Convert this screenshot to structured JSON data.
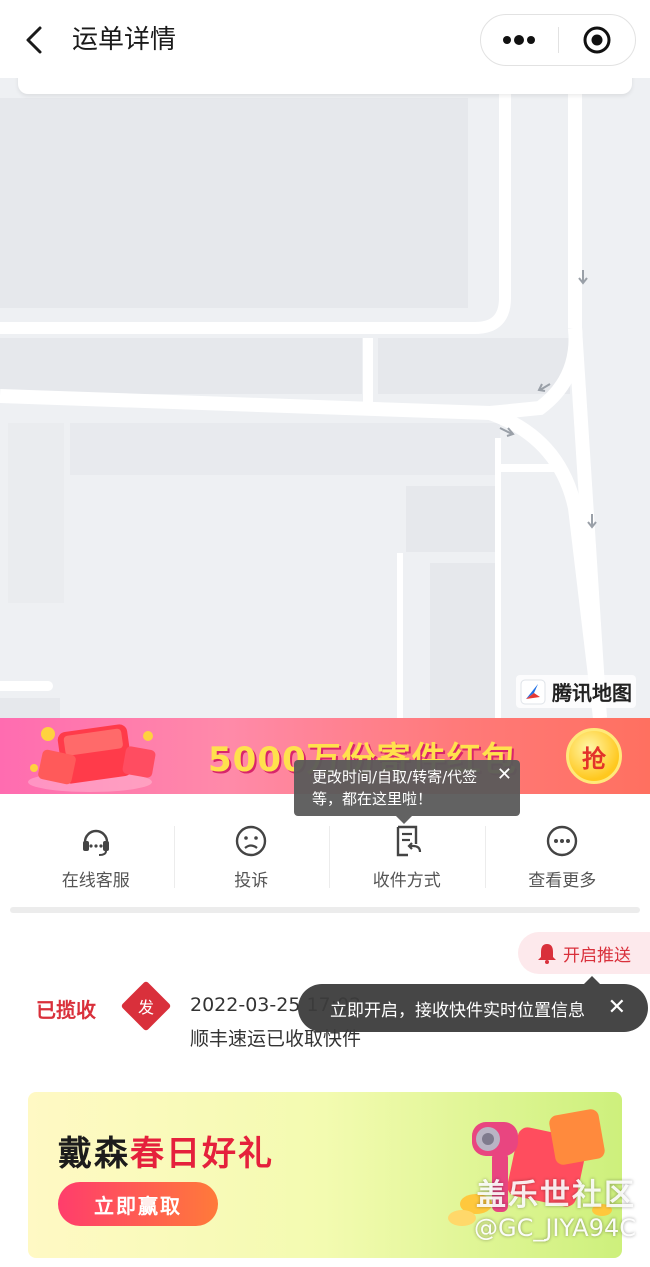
{
  "header": {
    "title": "运单详情",
    "back_icon": "chevron-left-icon",
    "more_icon": "more-dots-icon",
    "target_icon": "record-icon"
  },
  "map": {
    "provider_label": "腾讯地图"
  },
  "banner": {
    "text": "5000万份寄件红包",
    "grab_label": "抢"
  },
  "tooltip_actions": {
    "text": "更改时间/自取/转寄/代签等，都在这里啦！",
    "close": "✕"
  },
  "actions": [
    {
      "label": "在线客服",
      "icon": "headset-icon"
    },
    {
      "label": "投诉",
      "icon": "sad-face-icon"
    },
    {
      "label": "收件方式",
      "icon": "document-return-icon"
    },
    {
      "label": "查看更多",
      "icon": "more-circle-icon"
    }
  ],
  "push": {
    "label": "开启推送",
    "icon": "bell-icon",
    "tooltip": "立即开启，接收快件实时位置信息",
    "close": "✕"
  },
  "timeline": {
    "status": "已揽收",
    "badge": "发",
    "time": "2022-03-25 17:02",
    "description": "顺丰速运已收取快件"
  },
  "ad": {
    "title_part1": "戴森",
    "title_part2": "春日好礼",
    "button": "立即赢取"
  },
  "watermark": {
    "line1": "盖乐世社区",
    "line2": "@GC_JIYA94C"
  },
  "colors": {
    "accent_red": "#d9303b",
    "map_bg": "#eef0f3"
  }
}
